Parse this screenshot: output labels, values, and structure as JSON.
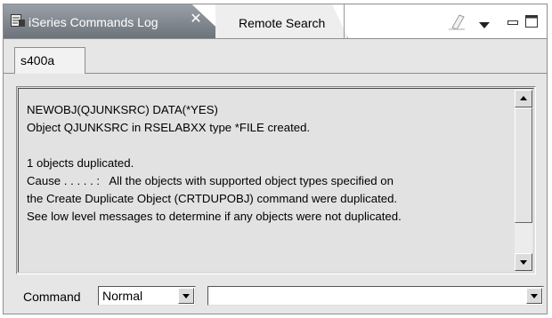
{
  "view_tabs": {
    "active": {
      "label": "iSeries Commands Log",
      "icon": "log-view-icon",
      "close_icon": "close-icon"
    },
    "inactive": {
      "label": "Remote Search"
    }
  },
  "view_toolbar": {
    "icons": [
      "clear-log-icon",
      "view-menu-icon",
      "minimize-icon",
      "maximize-icon"
    ]
  },
  "inner_tab": {
    "label": "s400a"
  },
  "log": {
    "lines": [
      "NEWOBJ(QJUNKSRC) DATA(*YES)",
      "Object QJUNKSRC in RSELABXX type *FILE created.",
      "",
      "1 objects duplicated.",
      "Cause . . . . . :   All the objects with supported object types specified on",
      "the Create Duplicate Object (CRTDUPOBJ) command were duplicated.",
      "See low level messages to determine if any objects were not duplicated."
    ]
  },
  "command": {
    "label": "Command",
    "mode_value": "Normal",
    "command_value": ""
  }
}
